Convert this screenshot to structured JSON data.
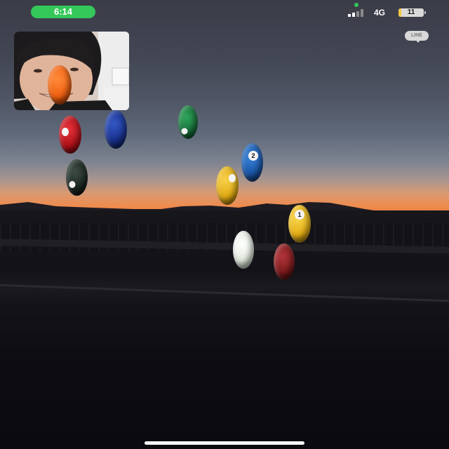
{
  "status_bar": {
    "time": "6:14",
    "network": "4G",
    "battery_level": "11",
    "battery_fraction": 0.11,
    "time_pill_color": "#34c759"
  },
  "app_badge": {
    "label": "LINE"
  },
  "self_view": {
    "description_icon": "user-video-feed-icon"
  },
  "effects": [
    {
      "name": "orange-ball-on-face",
      "color": "#f26d1d",
      "number": ""
    },
    {
      "name": "red-ball",
      "color": "#c8151d",
      "number": ""
    },
    {
      "name": "blue-ball",
      "color": "#1c3a9c",
      "number": ""
    },
    {
      "name": "green-ball",
      "color": "#1f7f3e",
      "number": ""
    },
    {
      "name": "black-ball",
      "color": "#1e2a22",
      "number": ""
    },
    {
      "name": "blue-ball-2",
      "color": "#1e5fb8",
      "number": "2"
    },
    {
      "name": "yellow-striped-ball",
      "color": "#e8b21c",
      "number": ""
    },
    {
      "name": "yellow-ball-1",
      "color": "#f0c020",
      "number": "1"
    },
    {
      "name": "cue-ball",
      "color": "#e9efe6",
      "number": ""
    },
    {
      "name": "maroon-ball",
      "color": "#8a1e1e",
      "number": ""
    }
  ],
  "home_indicator": {
    "color": "#f5f5f5"
  }
}
